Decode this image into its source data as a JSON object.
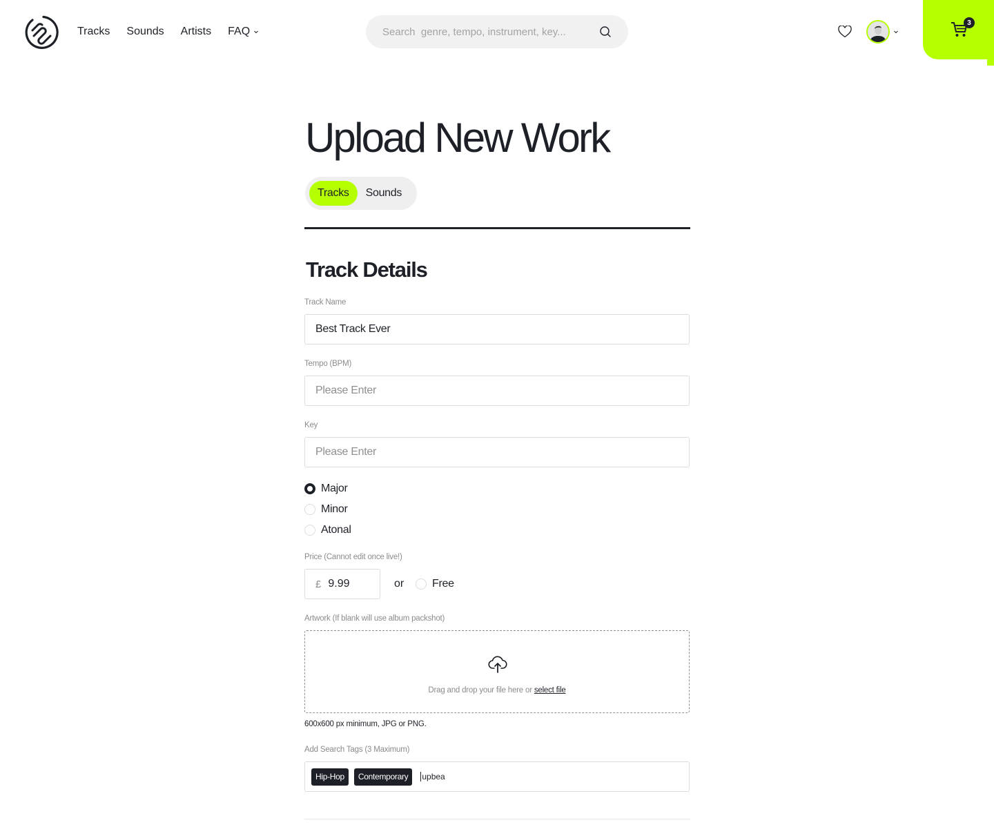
{
  "header": {
    "nav": [
      {
        "label": "Tracks"
      },
      {
        "label": "Sounds"
      },
      {
        "label": "Artists"
      },
      {
        "label": "FAQ",
        "has_dropdown": true
      }
    ],
    "search": {
      "placeholder": "Search  genre, tempo, instrument, key..."
    },
    "cart": {
      "count": "3"
    },
    "accent_color": "#b5ff00"
  },
  "page": {
    "title": "Upload New Work",
    "segments": [
      {
        "label": "Tracks",
        "active": true
      },
      {
        "label": "Sounds",
        "active": false
      }
    ],
    "section_title": "Track Details"
  },
  "form": {
    "track_name": {
      "label": "Track Name",
      "value": "Best Track Ever"
    },
    "tempo": {
      "label": "Tempo (BPM)",
      "placeholder": "Please Enter",
      "value": ""
    },
    "key": {
      "label": "Key",
      "placeholder": "Please Enter",
      "value": ""
    },
    "key_mode": {
      "options": [
        {
          "label": "Major",
          "selected": true
        },
        {
          "label": "Minor",
          "selected": false
        },
        {
          "label": "Atonal",
          "selected": false
        }
      ]
    },
    "price": {
      "label": "Price (Cannot edit once live!)",
      "currency": "£",
      "value": "9.99",
      "or_text": "or",
      "free_label": "Free",
      "free_selected": false
    },
    "artwork": {
      "label": "Artwork (If blank will use album packshot)",
      "drop_text": "Drag and drop your file here or ",
      "select_link": "select file",
      "hint": "600x600 px minimum, JPG or PNG."
    },
    "tags": {
      "label": "Add Search Tags (3 Maximum)",
      "items": [
        "Hip-Hop",
        "Contemporary"
      ],
      "input_value": "upbea"
    }
  }
}
